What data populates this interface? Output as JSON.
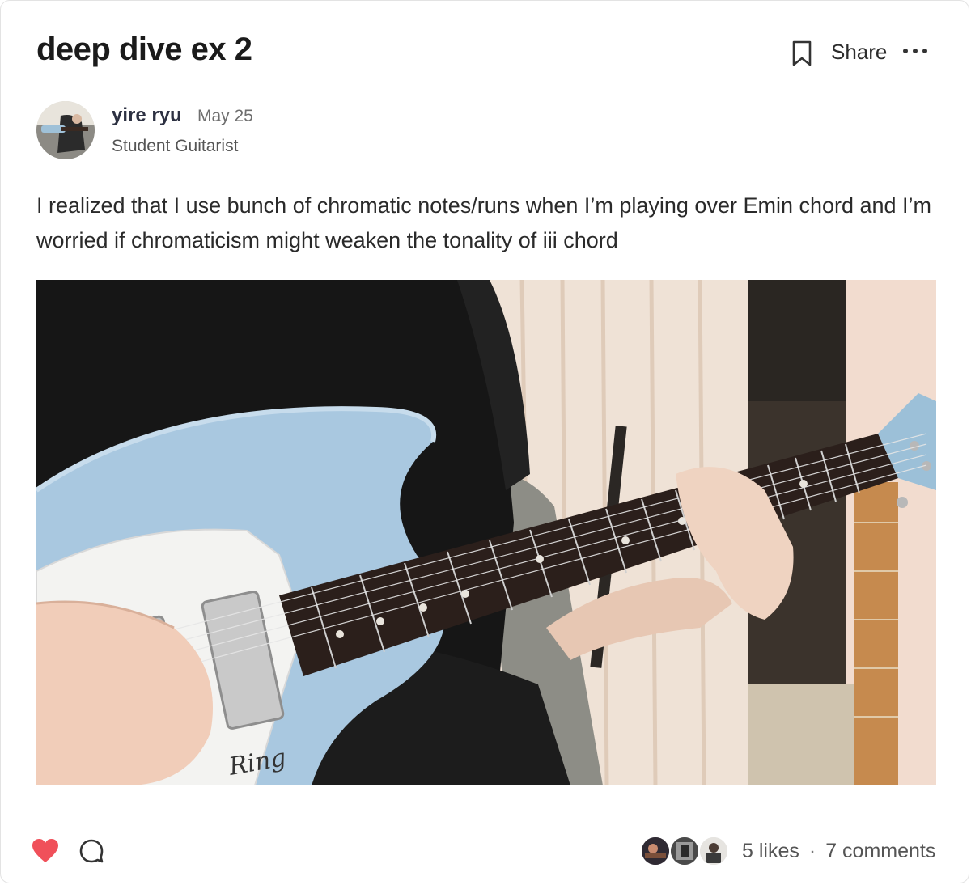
{
  "post": {
    "title": "deep dive ex 2",
    "share_label": "Share",
    "author": {
      "name": "yire ryu",
      "date": "May 25",
      "role": "Student Guitarist"
    },
    "body": "I realized that I use bunch of chromatic notes/runs when I’m playing over Emin chord and I’m worried if chromaticism might weaken the tonality of iii chord"
  },
  "footer": {
    "likes": "5 likes",
    "separator": "·",
    "comments": "7 comments"
  },
  "icons": {
    "bookmark": "bookmark-icon",
    "more": "more-options-icon",
    "heart": "heart-icon",
    "comment": "comment-icon"
  },
  "colors": {
    "heart": "#f0505a",
    "guitar_body": "#a9c8e0",
    "text": "#2a2a2a"
  }
}
